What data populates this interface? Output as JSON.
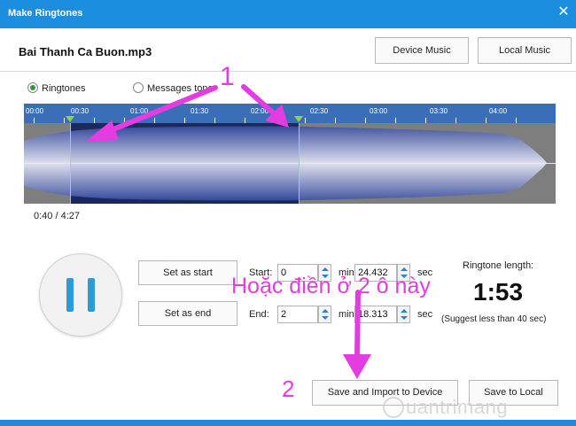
{
  "window": {
    "title": "Make Ringtones",
    "close_icon": "close-icon"
  },
  "file": {
    "name": "Bai Thanh Ca Buon.mp3"
  },
  "header_buttons": {
    "device_music": "Device Music",
    "local_music": "Local Music"
  },
  "mode": {
    "options": [
      {
        "label": "Ringtones",
        "selected": true
      },
      {
        "label": "Messages tone",
        "selected": false
      }
    ]
  },
  "timeline": {
    "ticks": [
      "00:00",
      "00:30",
      "01:00",
      "01:30",
      "02:00",
      "02:30",
      "03:00",
      "03:30",
      "04:00"
    ],
    "selection_start_sec": 30,
    "selection_end_sec": 145,
    "total_sec": 267
  },
  "playback": {
    "position": "0:40 / 4:27",
    "state": "playing",
    "button_icon": "pause-icon"
  },
  "controls": {
    "set_start": "Set as start",
    "set_end": "Set as end",
    "start_label": "Start:",
    "end_label": "End:",
    "start_min": "0",
    "start_sec": "24.432",
    "end_min": "2",
    "end_sec": "18.313",
    "min_unit": "min",
    "sec_unit": "sec"
  },
  "ringtone": {
    "length_label": "Ringtone length:",
    "length_value": "1:53",
    "note": "(Suggest less than 40 sec)"
  },
  "footer_buttons": {
    "save_import": "Save and Import to Device",
    "save_local": "Save to Local"
  },
  "annotations": {
    "number_1": "1",
    "number_2": "2",
    "hint": "Hoặc điền ở 2 ô này",
    "color": "#e33ce0"
  },
  "watermark": {
    "text": "uantrimang"
  },
  "colors": {
    "titlebar": "#1c8ee0",
    "timeline": "#3a6fb8",
    "selection": "#8bd44a",
    "play_icon": "#2d9ad8"
  }
}
